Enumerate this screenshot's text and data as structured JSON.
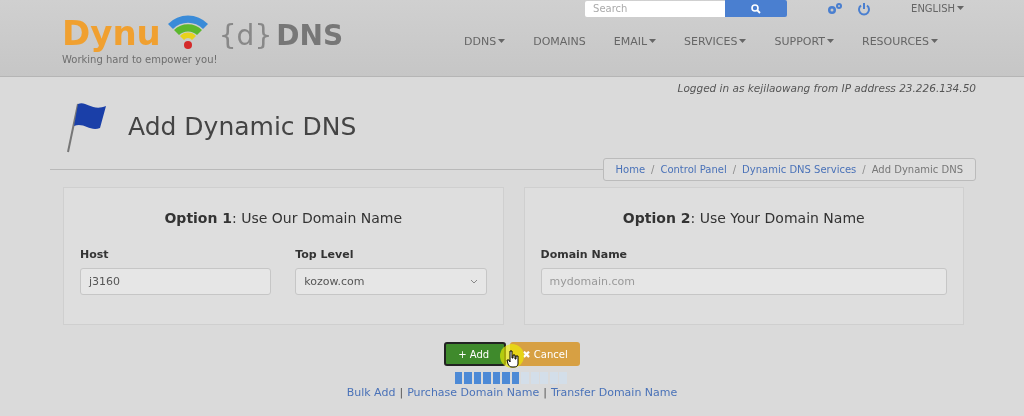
{
  "header": {
    "logo": {
      "word": "Dynu",
      "product_brace": "{d}",
      "product": "DNS",
      "tagline": "Working hard to empower you!"
    },
    "search": {
      "placeholder": "Search"
    },
    "language": "ENGLISH",
    "nav": [
      {
        "label": "DDNS",
        "dropdown": true
      },
      {
        "label": "DOMAINS",
        "dropdown": false
      },
      {
        "label": "EMAIL",
        "dropdown": true
      },
      {
        "label": "SERVICES",
        "dropdown": true
      },
      {
        "label": "SUPPORT",
        "dropdown": true
      },
      {
        "label": "RESOURCES",
        "dropdown": true
      }
    ]
  },
  "login_info": "Logged in as kejilaowang from IP address 23.226.134.50",
  "page_title": "Add Dynamic DNS",
  "breadcrumb": [
    {
      "label": "Home",
      "current": false
    },
    {
      "label": "Control Panel",
      "current": false
    },
    {
      "label": "Dynamic DNS Services",
      "current": false
    },
    {
      "label": "Add Dynamic DNS",
      "current": true
    }
  ],
  "breadcrumb_separators": [
    "/",
    "/",
    "/"
  ],
  "options": [
    {
      "title": "**Option 1**: Use Our Domain Name",
      "fields": [
        {
          "kind": "input",
          "label": "Host",
          "value": "j3160"
        },
        {
          "kind": "select",
          "label": "Top Level",
          "value": "kozow.com"
        }
      ]
    },
    {
      "title": "**Option 2**: Use Your Domain Name",
      "fields": [
        {
          "kind": "input",
          "label": "Domain Name",
          "placeholder": "mydomain.com"
        }
      ]
    }
  ],
  "buttons": [
    {
      "kind": "add",
      "label": "Add",
      "icon": "+"
    },
    {
      "kind": "cancel",
      "label": "Cancel",
      "icon": "✖"
    }
  ],
  "progress": {
    "level": 0.58
  },
  "links": [
    "Bulk Add",
    "Purchase Domain Name",
    "Transfer Domain Name"
  ],
  "separators": [
    "|",
    "|"
  ]
}
